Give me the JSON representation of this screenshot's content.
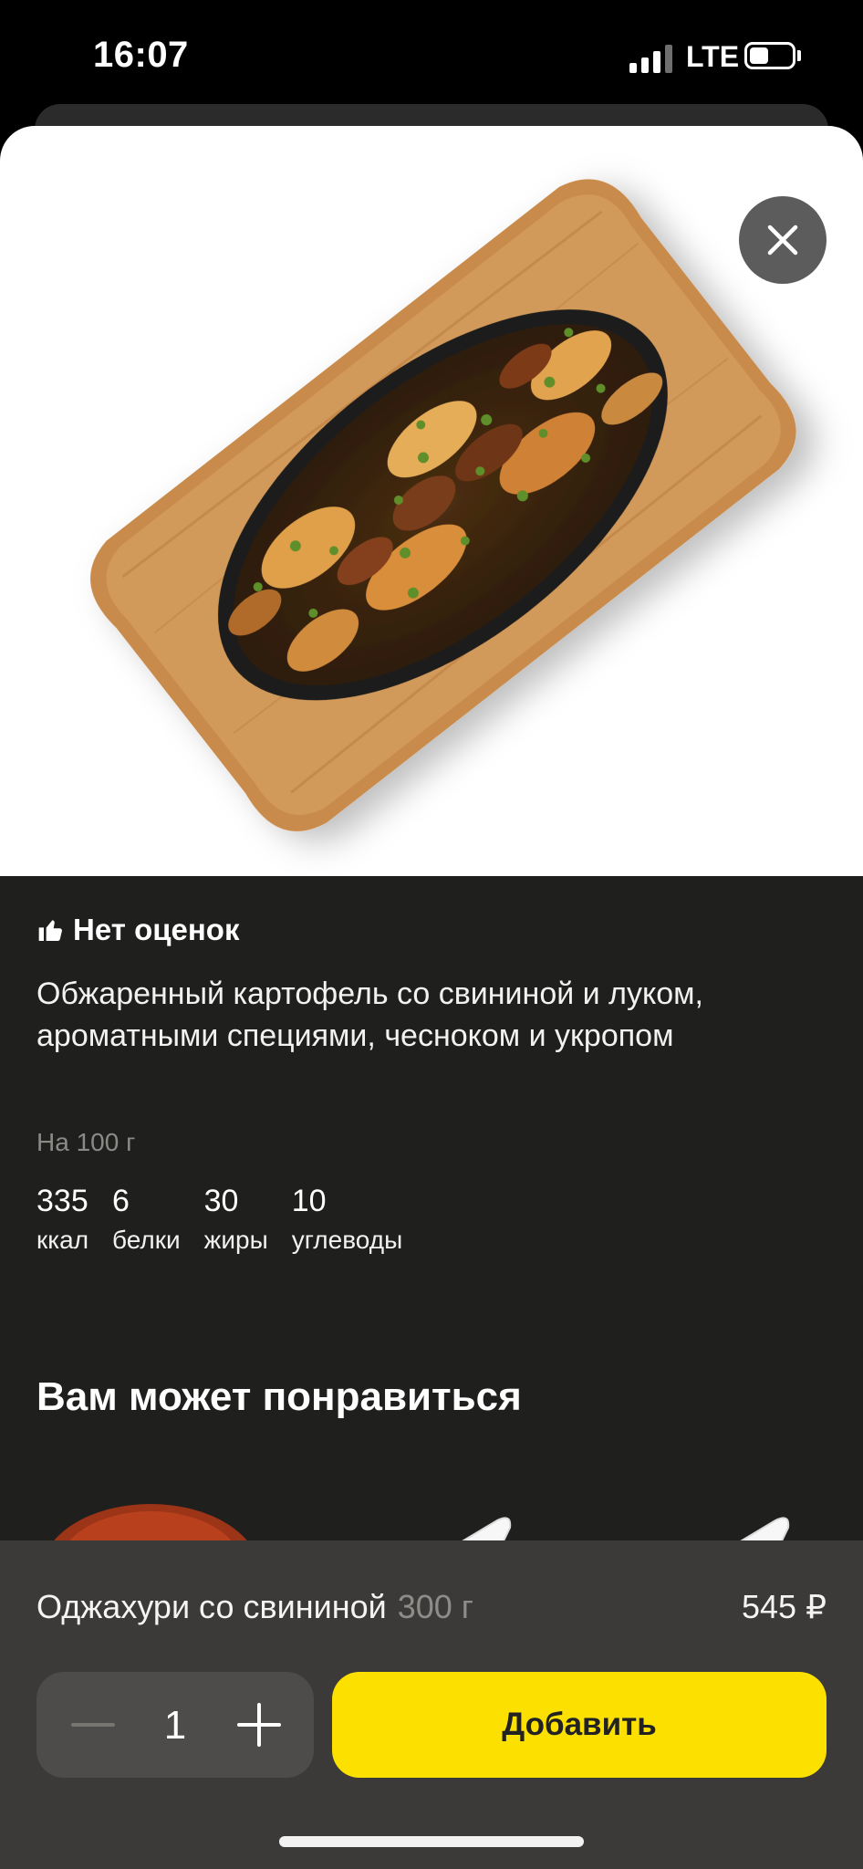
{
  "status_bar": {
    "time": "16:07",
    "network": "LTE",
    "signal_bars_active": 3,
    "signal_bars_total": 4,
    "battery_level": 0.4
  },
  "product": {
    "name": "Оджахури со свининой",
    "weight": "300 г",
    "price": "545 ₽",
    "rating_text": "Нет оценок",
    "description": "Обжаренный картофель со свининой и луком, ароматными специями, чесноком и укропом",
    "nutrition_basis": "На 100 г",
    "nutrition": [
      {
        "value": "335",
        "label": "ккал"
      },
      {
        "value": "6",
        "label": "белки"
      },
      {
        "value": "30",
        "label": "жиры"
      },
      {
        "value": "10",
        "label": "углеводы"
      }
    ]
  },
  "recommendations": {
    "title": "Вам может понравиться",
    "items": [
      {
        "icon": "soup-bowl-image"
      },
      {
        "icon": "red-sauce-boat-image"
      },
      {
        "icon": "white-sauce-boat-image"
      }
    ]
  },
  "cart_controls": {
    "quantity": "1",
    "add_label": "Добавить"
  },
  "colors": {
    "accent": "#fce000",
    "sheet_bg": "#1f1f1d",
    "bottom_bar_bg": "#3b3a38"
  }
}
